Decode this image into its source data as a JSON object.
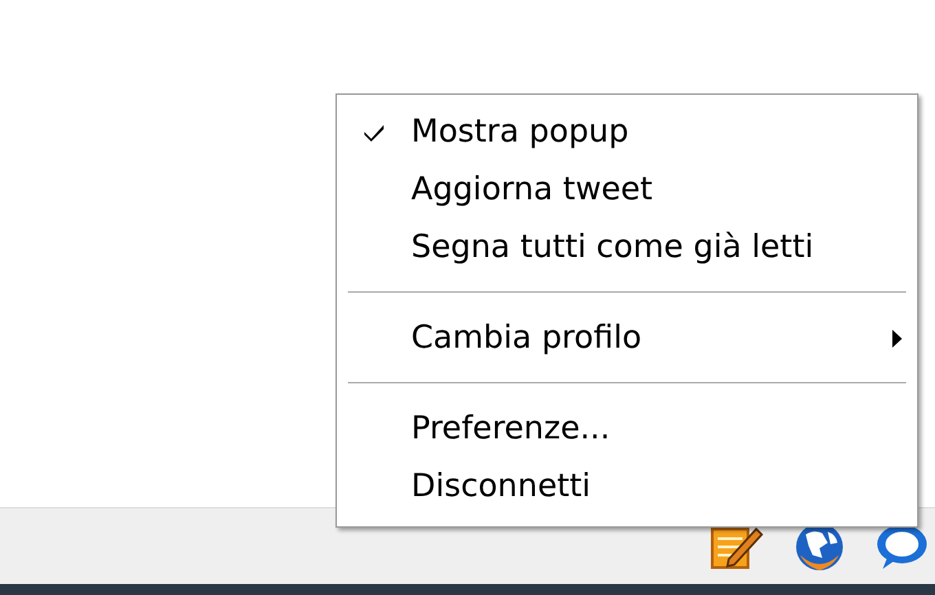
{
  "context_menu": {
    "items": [
      {
        "kind": "item",
        "label": "Mostra popup",
        "checked": true,
        "submenu": false
      },
      {
        "kind": "item",
        "label": "Aggiorna tweet",
        "checked": false,
        "submenu": false
      },
      {
        "kind": "item",
        "label": "Segna tutti come già letti",
        "checked": false,
        "submenu": false
      },
      {
        "kind": "separator"
      },
      {
        "kind": "item",
        "label": "Cambia profilo",
        "checked": false,
        "submenu": true
      },
      {
        "kind": "separator"
      },
      {
        "kind": "item",
        "label": "Preferenze...",
        "checked": false,
        "submenu": false
      },
      {
        "kind": "item",
        "label": "Disconnetti",
        "checked": false,
        "submenu": false
      }
    ]
  },
  "tray": {
    "icons": [
      {
        "kind": "notepad"
      },
      {
        "kind": "globe"
      },
      {
        "kind": "chat"
      }
    ]
  }
}
